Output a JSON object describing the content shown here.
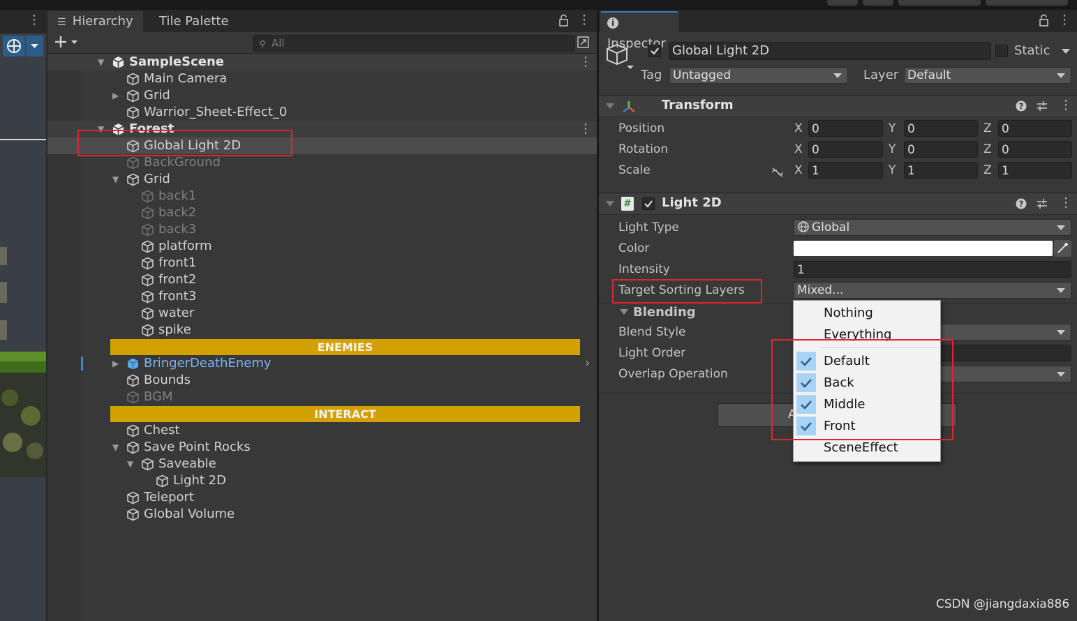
{
  "hierarchy": {
    "tabs": [
      "Hierarchy",
      "Tile Palette"
    ],
    "search_placeholder": "All",
    "rows": [
      {
        "label": "SampleScene",
        "style": "scene",
        "icon": "unity-scene-icon",
        "arrow": "expanded"
      },
      {
        "label": "Main Camera",
        "style": "normal",
        "icon": "gameobject-cube-icon"
      },
      {
        "label": "Grid",
        "style": "normal",
        "icon": "gameobject-cube-icon",
        "arrow": "collapsed"
      },
      {
        "label": "Warrior_Sheet-Effect_0",
        "style": "normal",
        "icon": "gameobject-cube-icon"
      },
      {
        "label": "Forest",
        "style": "scene",
        "icon": "unity-scene-icon",
        "arrow": "expanded"
      },
      {
        "label": "Global Light 2D",
        "style": "normal",
        "icon": "gameobject-cube-icon",
        "selected": true
      },
      {
        "label": "BackGround",
        "style": "dim",
        "icon": "gameobject-cube-icon"
      },
      {
        "label": "Grid",
        "style": "normal",
        "icon": "gameobject-cube-icon",
        "arrow": "expanded"
      },
      {
        "label": "back1",
        "style": "dim",
        "icon": "gameobject-cube-icon"
      },
      {
        "label": "back2",
        "style": "dim",
        "icon": "gameobject-cube-icon"
      },
      {
        "label": "back3",
        "style": "dim",
        "icon": "gameobject-cube-icon"
      },
      {
        "label": "platform",
        "style": "normal",
        "icon": "gameobject-cube-icon"
      },
      {
        "label": "front1",
        "style": "normal",
        "icon": "gameobject-cube-icon"
      },
      {
        "label": "front2",
        "style": "normal",
        "icon": "gameobject-cube-icon"
      },
      {
        "label": "front3",
        "style": "normal",
        "icon": "gameobject-cube-icon"
      },
      {
        "label": "water",
        "style": "normal",
        "icon": "gameobject-cube-icon"
      },
      {
        "label": "spike",
        "style": "normal",
        "icon": "gameobject-cube-icon"
      },
      {
        "label": "ENEMIES",
        "style": "header"
      },
      {
        "label": "BringerDeathEnemy",
        "style": "prefab",
        "icon": "prefab-cube-icon",
        "arrow": "collapsed"
      },
      {
        "label": "Bounds",
        "style": "normal",
        "icon": "gameobject-cube-icon"
      },
      {
        "label": "BGM",
        "style": "dim",
        "icon": "gameobject-cube-icon"
      },
      {
        "label": "INTERACT",
        "style": "header"
      },
      {
        "label": "Chest",
        "style": "normal",
        "icon": "gameobject-cube-icon"
      },
      {
        "label": "Save Point Rocks",
        "style": "normal",
        "icon": "gameobject-cube-icon",
        "arrow": "expanded"
      },
      {
        "label": "Saveable",
        "style": "normal",
        "icon": "gameobject-cube-icon",
        "arrow": "expanded"
      },
      {
        "label": "Light 2D",
        "style": "normal",
        "icon": "gameobject-cube-icon"
      },
      {
        "label": "Teleport",
        "style": "normal",
        "icon": "gameobject-cube-icon"
      },
      {
        "label": "Global Volume",
        "style": "normal",
        "icon": "gameobject-cube-icon"
      }
    ]
  },
  "inspector": {
    "tab": "Inspector",
    "object_name": "Global Light 2D",
    "active": true,
    "static_label": "Static",
    "tag_label": "Tag",
    "tag_value": "Untagged",
    "layer_label": "Layer",
    "layer_value": "Default",
    "transform": {
      "title": "Transform",
      "rows": [
        {
          "label": "Position",
          "x": "0",
          "y": "0",
          "z": "0"
        },
        {
          "label": "Rotation",
          "x": "0",
          "y": "0",
          "z": "0"
        },
        {
          "label": "Scale",
          "x": "1",
          "y": "1",
          "z": "1"
        }
      ],
      "axes": [
        "X",
        "Y",
        "Z"
      ]
    },
    "light2d": {
      "title": "Light 2D",
      "enabled": true,
      "light_type_label": "Light Type",
      "light_type_value": "Global",
      "color_label": "Color",
      "color_value": "#ffffff",
      "intensity_label": "Intensity",
      "intensity_value": "1",
      "sorting_label": "Target Sorting Layers",
      "sorting_value": "Mixed...",
      "blending_label": "Blending",
      "blend_style_label": "Blend Style",
      "light_order_label": "Light Order",
      "overlap_label": "Overlap Operation",
      "add_component_fragment": "A"
    }
  },
  "sorting_layer_menu": {
    "items": [
      {
        "label": "Nothing",
        "checked": false
      },
      {
        "label": "Everything",
        "checked": false
      },
      {
        "label": "Default",
        "checked": true
      },
      {
        "label": "Back",
        "checked": true
      },
      {
        "label": "Middle",
        "checked": true
      },
      {
        "label": "Front",
        "checked": true
      },
      {
        "label": "SceneEffect",
        "checked": false
      }
    ]
  },
  "colors": {
    "highlight_red": "#e0262d",
    "header_gold": "#d2a000",
    "prefab_blue": "#7bb4f2",
    "check_blue": "#a9d3f5"
  },
  "watermark": "CSDN @jiangdaxia886"
}
